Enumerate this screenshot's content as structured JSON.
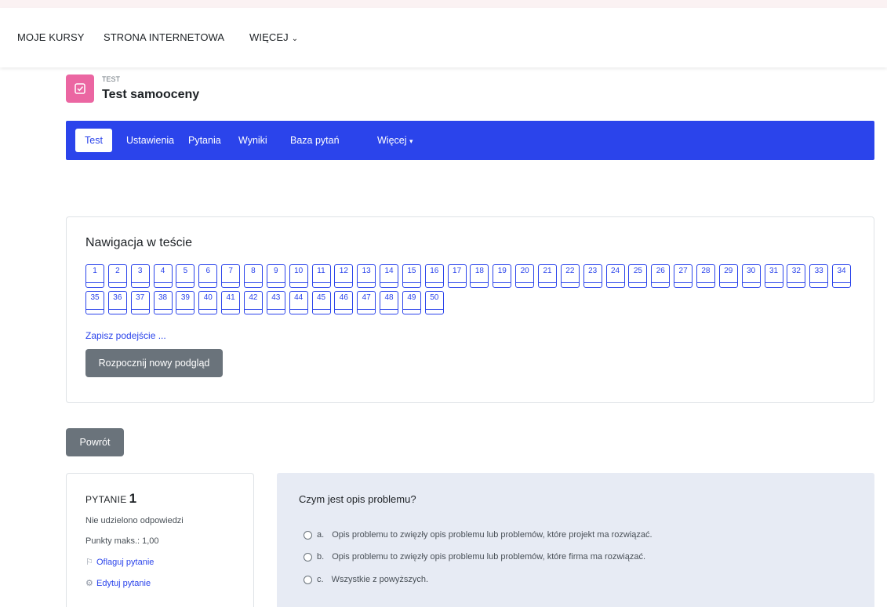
{
  "topnav": {
    "items": [
      "MOJE KURSY",
      "STRONA INTERNETOWA",
      "WIĘCEJ"
    ]
  },
  "header": {
    "kind": "TEST",
    "title": "Test samooceny",
    "icon": "quiz-icon",
    "icon_color": "#eb66a2"
  },
  "tabs": [
    "Test",
    "Ustawienia",
    "Pytania",
    "Wyniki",
    "Baza pytań",
    "Więcej"
  ],
  "accent": "#2b44eb",
  "quiz_nav": {
    "title": "Nawigacja w teście",
    "questions": [
      "1",
      "2",
      "3",
      "4",
      "5",
      "6",
      "7",
      "8",
      "9",
      "10",
      "11",
      "12",
      "13",
      "14",
      "15",
      "16",
      "17",
      "18",
      "19",
      "20",
      "21",
      "22",
      "23",
      "24",
      "25",
      "26",
      "27",
      "28",
      "29",
      "30",
      "31",
      "32",
      "33",
      "34",
      "35",
      "36",
      "37",
      "38",
      "39",
      "40",
      "41",
      "42",
      "43",
      "44",
      "45",
      "46",
      "47",
      "48",
      "49",
      "50"
    ],
    "save_link": "Zapisz podejście ...",
    "preview_button": "Rozpocznij nowy podgląd"
  },
  "back_button": "Powrót",
  "question_info": {
    "label": "PYTANIE",
    "number": "1",
    "status": "Nie udzielono odpowiedzi",
    "points": "Punkty maks.: 1,00",
    "flag_link": "Oflaguj pytanie",
    "edit_link": "Edytuj pytanie"
  },
  "question": {
    "text": "Czym jest opis problemu?",
    "answers": [
      {
        "letter": "a.",
        "text": "Opis problemu to zwięzły opis problemu lub problemów, które projekt ma rozwiązać."
      },
      {
        "letter": "b.",
        "text": "Opis problemu to zwięzły opis problemu lub problemów, które firma ma rozwiązać."
      },
      {
        "letter": "c.",
        "text": "Wszystkie z powyższych."
      }
    ]
  }
}
